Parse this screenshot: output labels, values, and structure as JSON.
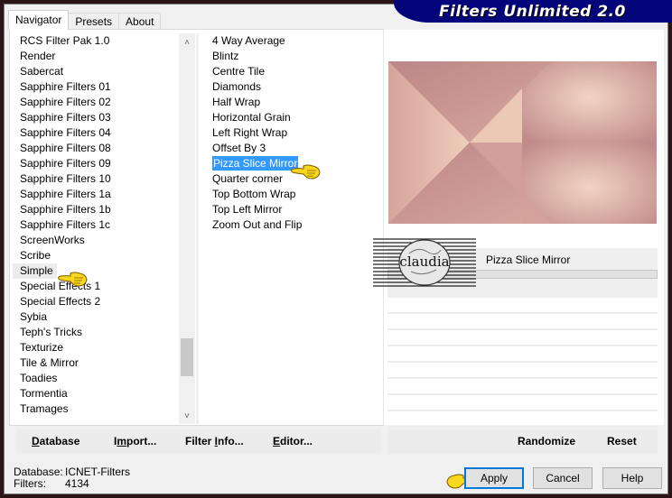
{
  "window": {
    "brand_title": "Filters Unlimited 2.0"
  },
  "tabs": [
    {
      "label": "Navigator",
      "active": true
    },
    {
      "label": "Presets",
      "active": false
    },
    {
      "label": "About",
      "active": false
    }
  ],
  "categories": {
    "items": [
      "RCS Filter Pak 1.0",
      "Render",
      "Sabercat",
      "Sapphire Filters 01",
      "Sapphire Filters 02",
      "Sapphire Filters 03",
      "Sapphire Filters 04",
      "Sapphire Filters 08",
      "Sapphire Filters 09",
      "Sapphire Filters 10",
      "Sapphire Filters 1a",
      "Sapphire Filters 1b",
      "Sapphire Filters 1c",
      "ScreenWorks",
      "Scribe",
      "Simple",
      "Special Effects 1",
      "Special Effects 2",
      "Sybia",
      "Teph's Tricks",
      "Texturize",
      "Tile & Mirror",
      "Toadies",
      "Tormentia",
      "Tramages"
    ],
    "selected": "Simple",
    "scroll_up_icon": "chevron-up-icon",
    "scroll_down_icon": "chevron-down-icon"
  },
  "filters": {
    "items": [
      "4 Way Average",
      "Blintz",
      "Centre Tile",
      "Diamonds",
      "Half Wrap",
      "Horizontal Grain",
      "Left Right Wrap",
      "Offset By 3",
      "Pizza Slice Mirror",
      "Quarter corner",
      "Top Bottom Wrap",
      "Top Left Mirror",
      "Zoom Out and Flip"
    ],
    "selected": "Pizza Slice Mirror"
  },
  "preview": {
    "colors": {
      "dark": "#c08a8a",
      "light": "#f2d4c2",
      "mid": "#d9a8a0"
    }
  },
  "selected_filter_name": "Pizza Slice Mirror",
  "watermark": {
    "text": "claudia"
  },
  "left_buttons": {
    "database": {
      "label": "Database",
      "mnemonic_index": 0
    },
    "import": {
      "label": "Import...",
      "mnemonic_index": 1
    },
    "filter_info": {
      "label": "Filter Info...",
      "mnemonic_index": 7
    },
    "editor": {
      "label": "Editor...",
      "mnemonic_index": 0
    }
  },
  "right_buttons": {
    "randomize": "Randomize",
    "reset": "Reset"
  },
  "status": {
    "database_label": "Database:",
    "database_value": "ICNET-Filters",
    "filters_label": "Filters:",
    "filters_value": "4134"
  },
  "dialog_buttons": {
    "apply": "Apply",
    "cancel": "Cancel",
    "help": "Help"
  },
  "accent_colors": {
    "selection": "#3399ff",
    "brand_bg": "#03037a",
    "default_button_border": "#0078d7"
  }
}
